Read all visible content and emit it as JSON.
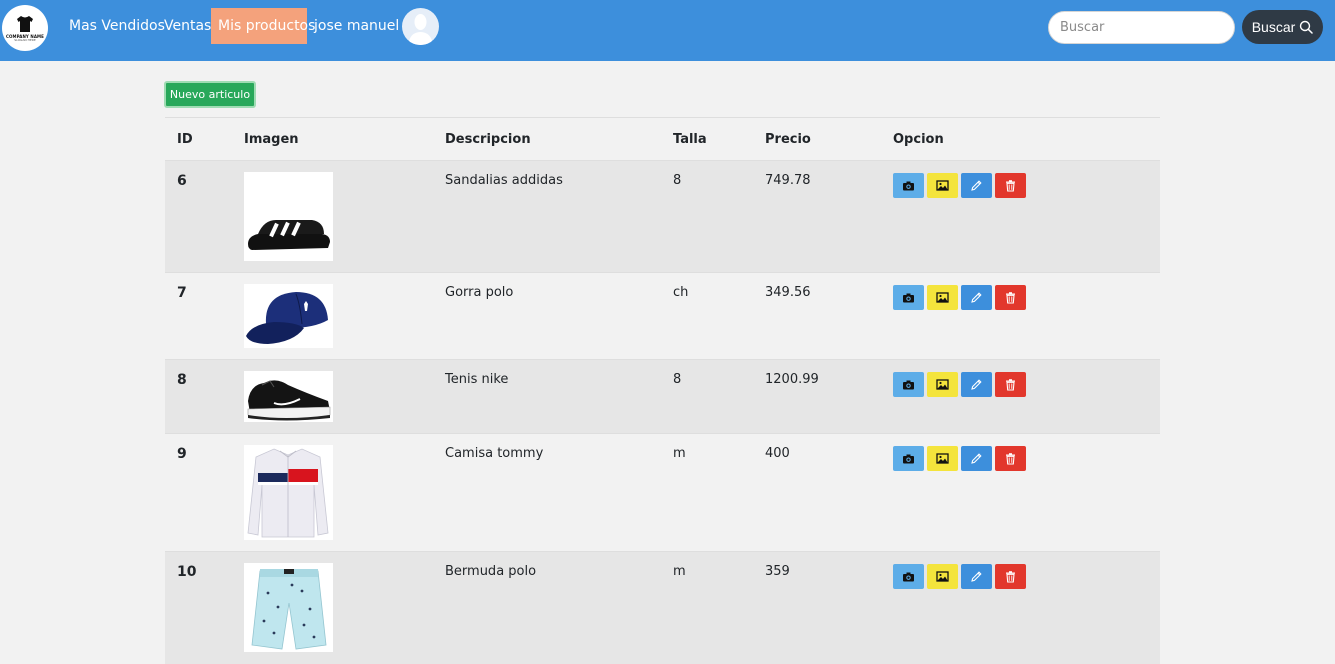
{
  "brand": {
    "name": "COMPANY NAME",
    "tagline": "SLOGAN HERE"
  },
  "nav": {
    "links": [
      "Mas Vendidos",
      "Ventas",
      "Mis productos"
    ],
    "active": "Mis productos",
    "user": "jose manuel"
  },
  "search": {
    "placeholder": "Buscar",
    "button_label": "Buscar"
  },
  "toolbar": {
    "new_label": "Nuevo articulo"
  },
  "table": {
    "columns": [
      "ID",
      "Imagen",
      "Descripcion",
      "Talla",
      "Precio",
      "Opcion"
    ],
    "rows": [
      {
        "id": "6",
        "description": "Sandalias addidas",
        "size": "8",
        "price": "749.78",
        "image_icon": "sandal-image"
      },
      {
        "id": "7",
        "description": "Gorra polo",
        "size": "ch",
        "price": "349.56",
        "image_icon": "cap-image"
      },
      {
        "id": "8",
        "description": "Tenis nike",
        "size": "8",
        "price": "1200.99",
        "image_icon": "sneaker-image"
      },
      {
        "id": "9",
        "description": "Camisa tommy",
        "size": "m",
        "price": "400",
        "image_icon": "shirt-image"
      },
      {
        "id": "10",
        "description": "Bermuda polo",
        "size": "m",
        "price": "359",
        "image_icon": "shorts-image"
      }
    ]
  },
  "colors": {
    "navbar": "#3d8fdc",
    "active_tab": "#f4a27c",
    "new_button": "#28a85a",
    "camera_button": "#5dade8",
    "image_button": "#f4e43c",
    "edit_button": "#3d8fdc",
    "delete_button": "#e2372c"
  }
}
